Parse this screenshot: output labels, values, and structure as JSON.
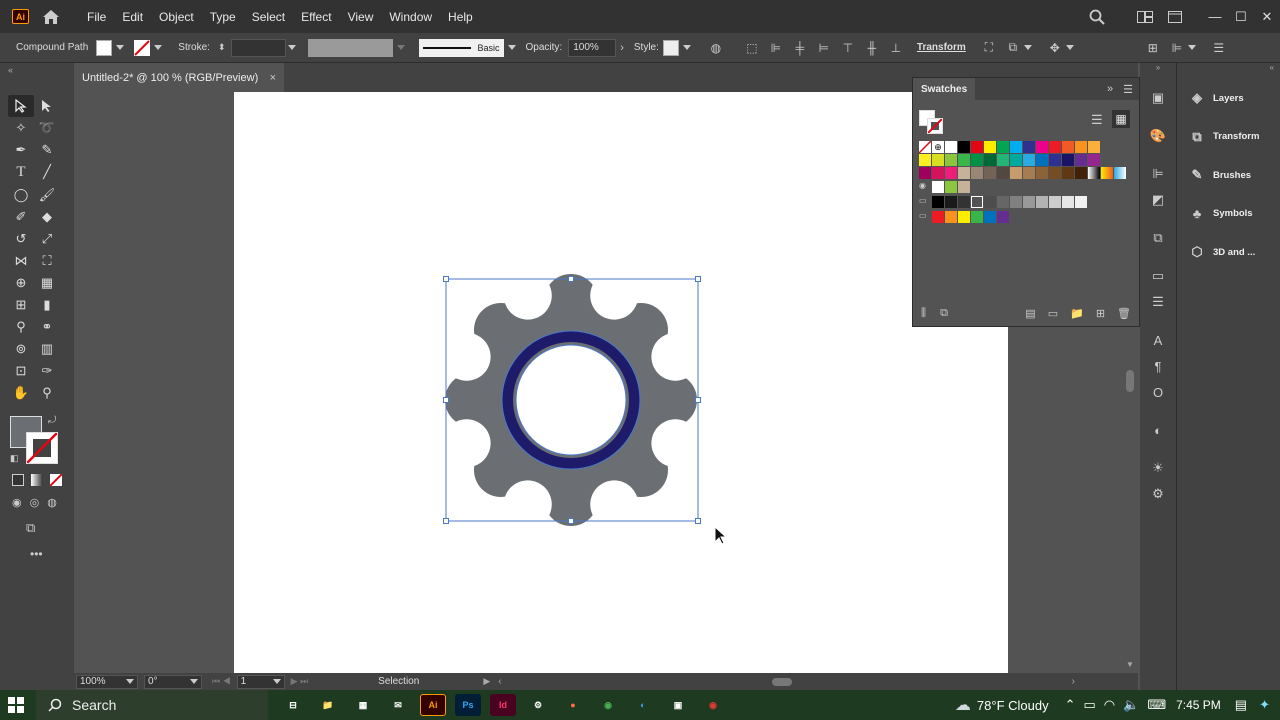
{
  "app": {
    "logo": "Ai",
    "home_icon": "home-icon"
  },
  "menu": [
    "File",
    "Edit",
    "Object",
    "Type",
    "Select",
    "Effect",
    "View",
    "Window",
    "Help"
  ],
  "control_bar": {
    "selection_type": "Compound Path",
    "stroke_label": "Stroke:",
    "brush_label": "Basic",
    "opacity_label": "Opacity:",
    "opacity_value": "100%",
    "style_label": "Style:",
    "transform_label": "Transform"
  },
  "document": {
    "tab_title": "Untitled-2* @ 100 % (RGB/Preview)",
    "close": "×"
  },
  "status_bar": {
    "zoom": "100%",
    "rotation": "0°",
    "artboard": "1",
    "tool": "Selection"
  },
  "swatches_panel": {
    "title": "Swatches",
    "rows": [
      [
        "none",
        "reg",
        "#ffffff",
        "#000000",
        "#e30613",
        "#ffed00",
        "#00a651",
        "#00aeef",
        "#2e3192",
        "#ec008c",
        "#ed1c24",
        "#f15a24",
        "#f7931e",
        "#fbb03b"
      ],
      [
        "#fcee21",
        "#d9e021",
        "#8cc63f",
        "#39b54a",
        "#009245",
        "#006837",
        "#22b573",
        "#00a99d",
        "#29abe2",
        "#0071bc",
        "#2e3192",
        "#1b1464",
        "#662d91",
        "#93278f"
      ],
      [
        "#9e005d",
        "#d4145a",
        "#ed1e79",
        "#c7b299",
        "#998675",
        "#736357",
        "#534741",
        "#c69c6d",
        "#a67c52",
        "#8c6239",
        "#754c24",
        "#603813",
        "#42210b",
        "grad-bw",
        "grad-org",
        "grad-blue"
      ],
      [
        "pattern-a",
        "pattern-b",
        "pattern-c"
      ],
      [
        "#000000",
        "#1a1a1a",
        "#333333",
        "outline",
        "#4d4d4d",
        "#666666",
        "#808080",
        "#999999",
        "#b3b3b3",
        "#cccccc",
        "#e6e6e6",
        "#f2f2f2"
      ],
      [
        "#ed1c24",
        "#f7931e",
        "#ffed00",
        "#39b54a",
        "#0071bc",
        "#662d91"
      ]
    ]
  },
  "right_panel": [
    {
      "label": "Layers",
      "icon": "layers-icon"
    },
    {
      "label": "Transform",
      "icon": "transform-icon"
    },
    {
      "label": "Brushes",
      "icon": "brushes-icon"
    },
    {
      "label": "Symbols",
      "icon": "symbols-icon"
    },
    {
      "label": "3D and ...",
      "icon": "cube-icon"
    }
  ],
  "artwork": {
    "gear_fill": "#6b6e72",
    "ring_color": "#1f1b6b",
    "selection_color": "#4a78c8"
  },
  "taskbar": {
    "search_placeholder": "Search",
    "weather": "78°F  Cloudy",
    "time": "7:45 PM"
  }
}
